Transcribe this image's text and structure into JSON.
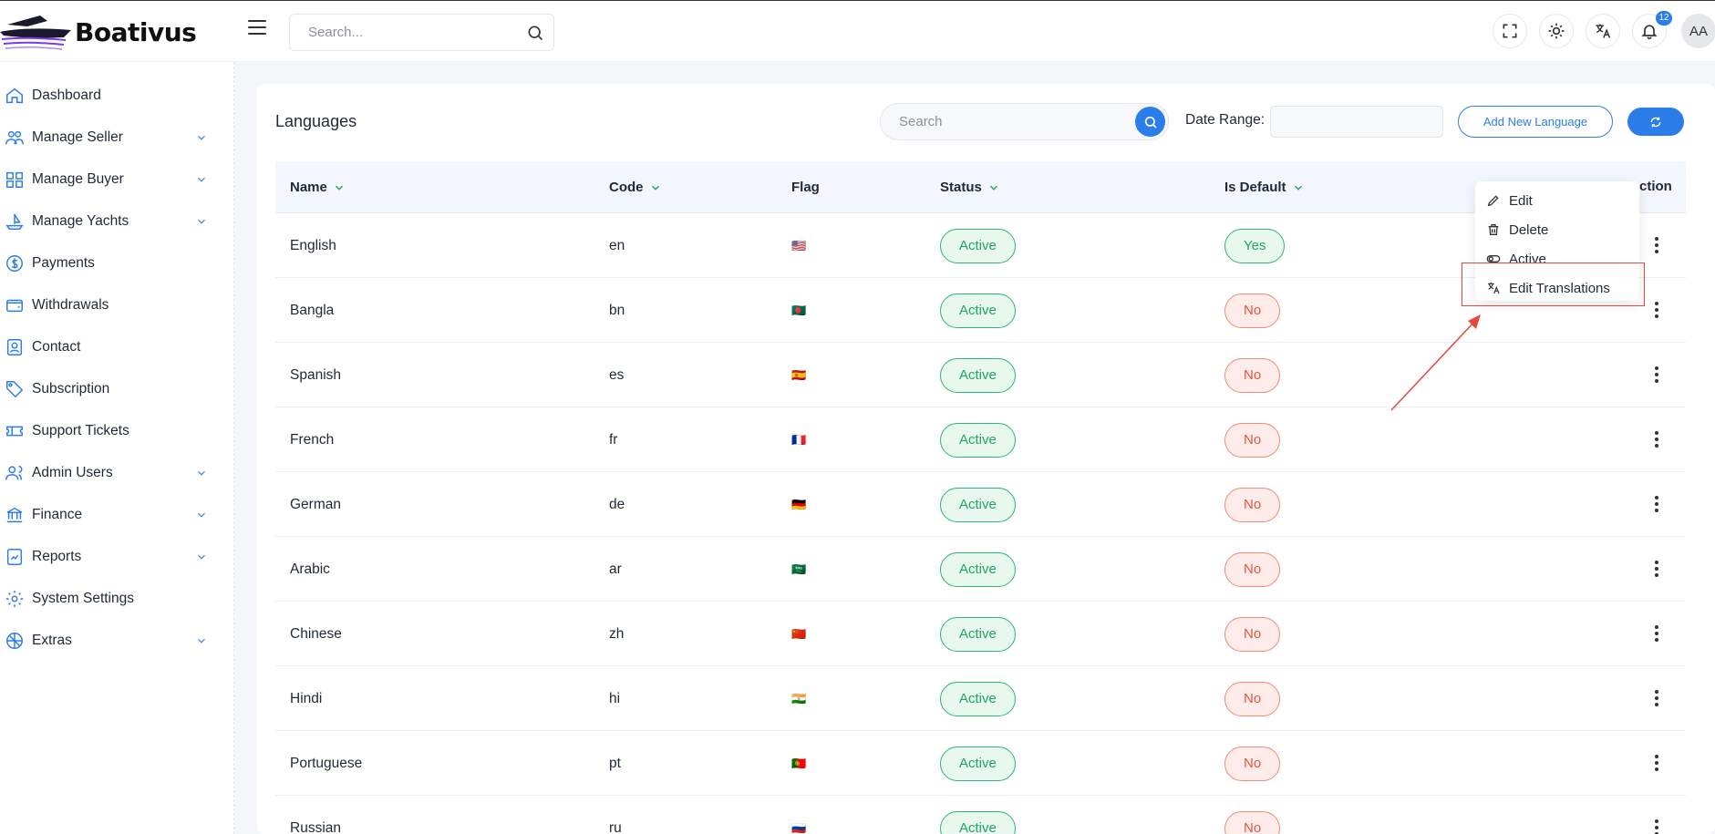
{
  "app": {
    "name": "Boativus"
  },
  "header": {
    "search_placeholder": "Search...",
    "notification_count": "12",
    "avatar_initials": "AA",
    "icons": [
      "fullscreen-icon",
      "sun-icon",
      "translate-icon",
      "bell-icon"
    ]
  },
  "sidebar": {
    "items": [
      {
        "label": "Dashboard",
        "icon": "home-icon",
        "has_children": false
      },
      {
        "label": "Manage Seller",
        "icon": "users-icon",
        "has_children": true
      },
      {
        "label": "Manage Buyer",
        "icon": "group-icon",
        "has_children": true
      },
      {
        "label": "Manage Yachts",
        "icon": "boat-icon",
        "has_children": true
      },
      {
        "label": "Payments",
        "icon": "dollar-icon",
        "has_children": false
      },
      {
        "label": "Withdrawals",
        "icon": "wallet-icon",
        "has_children": false
      },
      {
        "label": "Contact",
        "icon": "contact-icon",
        "has_children": false
      },
      {
        "label": "Subscription",
        "icon": "tag-icon",
        "has_children": false
      },
      {
        "label": "Support Tickets",
        "icon": "ticket-icon",
        "has_children": false
      },
      {
        "label": "Admin Users",
        "icon": "admin-users-icon",
        "has_children": true
      },
      {
        "label": "Finance",
        "icon": "bank-icon",
        "has_children": true
      },
      {
        "label": "Reports",
        "icon": "report-icon",
        "has_children": true
      },
      {
        "label": "System Settings",
        "icon": "settings-icon",
        "has_children": false
      },
      {
        "label": "Extras",
        "icon": "extras-icon",
        "has_children": true
      }
    ]
  },
  "page": {
    "title": "Languages",
    "search_placeholder": "Search",
    "date_range_label": "Date Range:",
    "add_button_label": "Add New Language"
  },
  "table": {
    "columns": [
      {
        "label": "Name",
        "sortable": true
      },
      {
        "label": "Code",
        "sortable": true
      },
      {
        "label": "Flag",
        "sortable": false
      },
      {
        "label": "Status",
        "sortable": true
      },
      {
        "label": "Is Default",
        "sortable": true
      },
      {
        "label": "ction",
        "sortable": false
      }
    ],
    "rows": [
      {
        "name": "English",
        "code": "en",
        "flag": "🇺🇸",
        "status": "Active",
        "is_default": "Yes"
      },
      {
        "name": "Bangla",
        "code": "bn",
        "flag": "🇧🇩",
        "status": "Active",
        "is_default": "No"
      },
      {
        "name": "Spanish",
        "code": "es",
        "flag": "🇪🇸",
        "status": "Active",
        "is_default": "No"
      },
      {
        "name": "French",
        "code": "fr",
        "flag": "🇫🇷",
        "status": "Active",
        "is_default": "No"
      },
      {
        "name": "German",
        "code": "de",
        "flag": "🇩🇪",
        "status": "Active",
        "is_default": "No"
      },
      {
        "name": "Arabic",
        "code": "ar",
        "flag": "🇸🇦",
        "status": "Active",
        "is_default": "No"
      },
      {
        "name": "Chinese",
        "code": "zh",
        "flag": "🇨🇳",
        "status": "Active",
        "is_default": "No"
      },
      {
        "name": "Hindi",
        "code": "hi",
        "flag": "🇮🇳",
        "status": "Active",
        "is_default": "No"
      },
      {
        "name": "Portuguese",
        "code": "pt",
        "flag": "🇵🇹",
        "status": "Active",
        "is_default": "No"
      },
      {
        "name": "Russian",
        "code": "ru",
        "flag": "🇷🇺",
        "status": "Active",
        "is_default": "No"
      }
    ]
  },
  "action_menu": {
    "items": [
      {
        "label": "Edit",
        "icon": "pencil-icon"
      },
      {
        "label": "Delete",
        "icon": "trash-icon"
      },
      {
        "label": "Active",
        "icon": "toggle-icon"
      },
      {
        "label": "Edit Translations",
        "icon": "translate-icon"
      }
    ]
  },
  "colors": {
    "primary": "#2b7de9",
    "success": "#1fa463",
    "danger": "#e5553b",
    "annotation": "#e5483a"
  }
}
